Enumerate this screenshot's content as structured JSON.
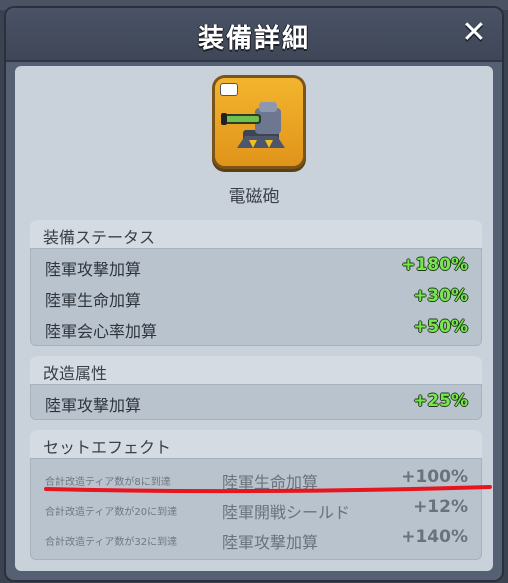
{
  "header": {
    "title": "装備詳細"
  },
  "item": {
    "name": "電磁砲"
  },
  "equip_status": {
    "title": "装備ステータス",
    "rows": [
      {
        "label": "陸軍攻撃加算",
        "value": "+180%"
      },
      {
        "label": "陸軍生命加算",
        "value": "+30%"
      },
      {
        "label": "陸軍会心率加算",
        "value": "+50%"
      }
    ]
  },
  "modify_attr": {
    "title": "改造属性",
    "rows": [
      {
        "label": "陸軍攻撃加算",
        "value": "+25%"
      }
    ]
  },
  "set_effect": {
    "title": "セットエフェクト",
    "rows": [
      {
        "condition": "合計改造ティア数が8に到達",
        "name": "陸軍生命加算",
        "value": "+100%"
      },
      {
        "condition": "合計改造ティア数が20に到達",
        "name": "陸軍開戦シールド",
        "value": "+12%"
      },
      {
        "condition": "合計改造ティア数が32に到達",
        "name": "陸軍攻撃加算",
        "value": "+140%"
      }
    ]
  },
  "colors": {
    "positive": "#78e64e",
    "annotation": "#e8141e"
  }
}
